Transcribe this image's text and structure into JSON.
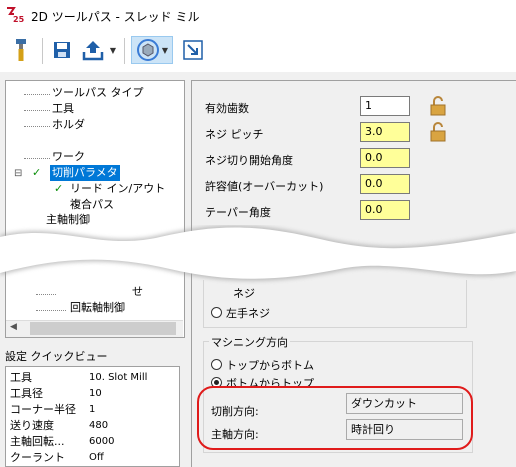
{
  "window": {
    "title": "2D ツールパス - スレッド ミル",
    "logo_text": "25"
  },
  "toolbar": {
    "buttons": [
      {
        "name": "tool-icon"
      },
      {
        "name": "save-icon"
      },
      {
        "name": "export-icon"
      },
      {
        "name": "view-icon"
      },
      {
        "name": "link-icon"
      }
    ]
  },
  "tree": {
    "items": [
      {
        "label": "ツールパス タイプ"
      },
      {
        "label": "工具"
      },
      {
        "label": "ホルダ"
      },
      {
        "label": "ワーク"
      },
      {
        "label": "切削パラメタ"
      },
      {
        "label": "リード イン/アウト"
      },
      {
        "label": "複合パス"
      },
      {
        "label": "主軸制御"
      },
      {
        "label": "せ"
      },
      {
        "label": "回転軸制御"
      }
    ]
  },
  "quick_view": {
    "title": "設定 クイックビュー",
    "rows": [
      {
        "label": "工具",
        "value": "10. Slot Mill"
      },
      {
        "label": "工具径",
        "value": "10"
      },
      {
        "label": "コーナー半径",
        "value": "1"
      },
      {
        "label": "送り速度",
        "value": "480"
      },
      {
        "label": "主軸回転...",
        "value": "6000"
      },
      {
        "label": "クーラント",
        "value": "Off"
      }
    ]
  },
  "params": {
    "teeth_label": "有効歯数",
    "teeth_value": "1",
    "pitch_label": "ネジ ピッチ",
    "pitch_value": "3.0",
    "start_angle_label": "ネジ切り開始角度",
    "start_angle_value": "0.0",
    "tolerance_label": "許容値(オーバーカット)",
    "tolerance_value": "0.0",
    "taper_label": "テーパー角度",
    "taper_value": "0.0"
  },
  "thread": {
    "partial_label": "ネジ",
    "left_label": "左手ネジ",
    "left_selected": false
  },
  "machining": {
    "title": "マシニング方向",
    "top_to_bottom": "トップからボトム",
    "bottom_to_top": "ボトムからトップ",
    "selected": "bottom_to_top",
    "cut_direction_label": "切削方向:",
    "cut_direction_value": "ダウンカット",
    "spindle_direction_label": "主軸方向:",
    "spindle_direction_value": "時計回り"
  },
  "colors": {
    "selection": "#0078d7",
    "highlight_field": "#ffff99",
    "callout": "#e01b1b",
    "lock": "#b8863b"
  }
}
